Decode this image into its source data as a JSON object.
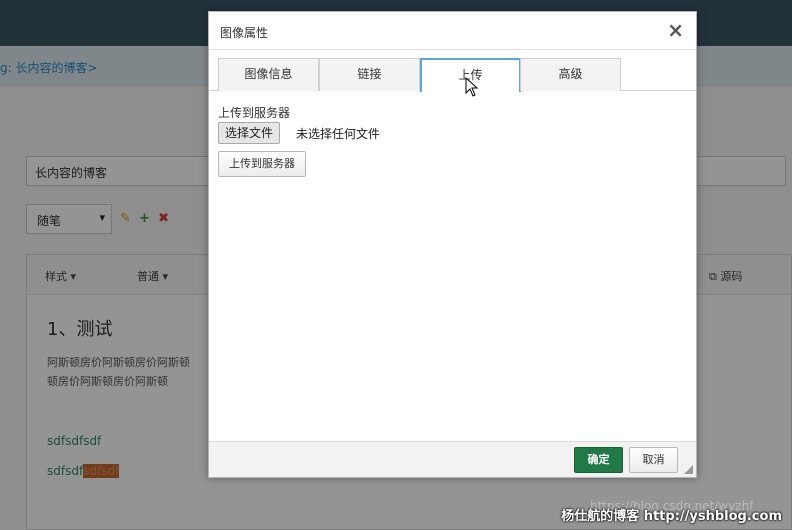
{
  "background": {
    "breadcrumb": "g: 长内容的博客>",
    "title_input_value": "长内容的博客",
    "category_select": "随笔",
    "toolbar": {
      "style_label": "样式",
      "format_label": "普通",
      "source_label": "源码"
    },
    "content": {
      "heading": "1、测试",
      "paragraph_line1": "阿斯顿房价阿斯顿房价阿斯顿",
      "paragraph_line2": "顿房价阿斯顿房价阿斯顿",
      "link1": "sdfsdfsdf",
      "link2_prefix": "sdfsdf",
      "link2_highlight": "sdfsdf"
    }
  },
  "dialog": {
    "title": "图像属性",
    "close_symbol": "×",
    "tabs": [
      {
        "label": "图像信息",
        "active": false
      },
      {
        "label": "链接",
        "active": false
      },
      {
        "label": "上传",
        "active": true
      },
      {
        "label": "高级",
        "active": false
      }
    ],
    "upload": {
      "label": "上传到服务器",
      "choose_file_button": "选择文件",
      "file_status": "未选择任何文件",
      "send_button": "上传到服务器"
    },
    "ok_button": "确定",
    "cancel_button": "取消"
  },
  "watermark": "杨仕航的博客 http://yshblog.com",
  "watermark_ghost": "https://blog.csdn.net/wyzhf",
  "colors": {
    "ok_button": "#1f7a45",
    "active_tab_border": "#5ba9dd",
    "topbar": "#3c5766"
  }
}
